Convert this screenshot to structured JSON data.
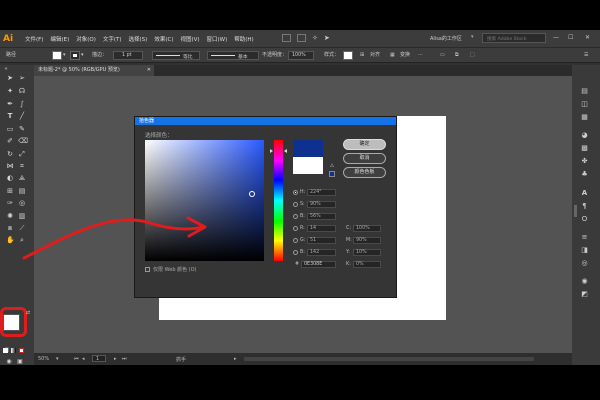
{
  "menubar": {
    "logo": "Ai",
    "menus": [
      "文件(F)",
      "编辑(E)",
      "对象(O)",
      "文字(T)",
      "选择(S)",
      "效果(C)",
      "视图(V)",
      "窗口(W)",
      "帮助(H)"
    ],
    "workspace": "Alisa的工作区",
    "search_placeholder": "搜索 Adobe Stock"
  },
  "optbar": {
    "label_path": "路径",
    "stroke_label": "描边：",
    "stroke_value": "1 pt",
    "profile_label": "等比",
    "brush_label": "基本",
    "opacity_label": "不透明度：",
    "opacity_value": "100%",
    "style_label": "样式：",
    "align_label": "对齐",
    "transform_label": "变换"
  },
  "document": {
    "tab_title": "未标题-2* @ 50% (RGB/GPU 预览)",
    "zoom": "50%",
    "page": "1",
    "status": "抓手"
  },
  "dialog": {
    "title": "拾色器",
    "subtitle": "选择颜色：",
    "ok": "确定",
    "cancel": "取消",
    "swatches": "颜色色板",
    "web_only": "仅限 Web 颜色 (O)",
    "hex_prefix": "#",
    "hex_value": "0E308E",
    "colors": {
      "new": "#0e308e",
      "old": "#ffffff"
    },
    "hsb": [
      {
        "label": "H:",
        "value": "224°",
        "selected": true
      },
      {
        "label": "S:",
        "value": "90%",
        "selected": false
      },
      {
        "label": "B:",
        "value": "56%",
        "selected": false
      }
    ],
    "rgb": [
      {
        "label": "R:",
        "value": "14"
      },
      {
        "label": "G:",
        "value": "51"
      },
      {
        "label": "B:",
        "value": "142"
      }
    ],
    "cmyk": [
      {
        "label": "C:",
        "value": "100%"
      },
      {
        "label": "M:",
        "value": "90%"
      },
      {
        "label": "Y:",
        "value": "10%"
      },
      {
        "label": "K:",
        "value": "0%"
      }
    ]
  },
  "colors": {
    "ui_dark": "#323232",
    "selection_blue": "#1473e6",
    "annotation_red": "#e01c1c"
  }
}
